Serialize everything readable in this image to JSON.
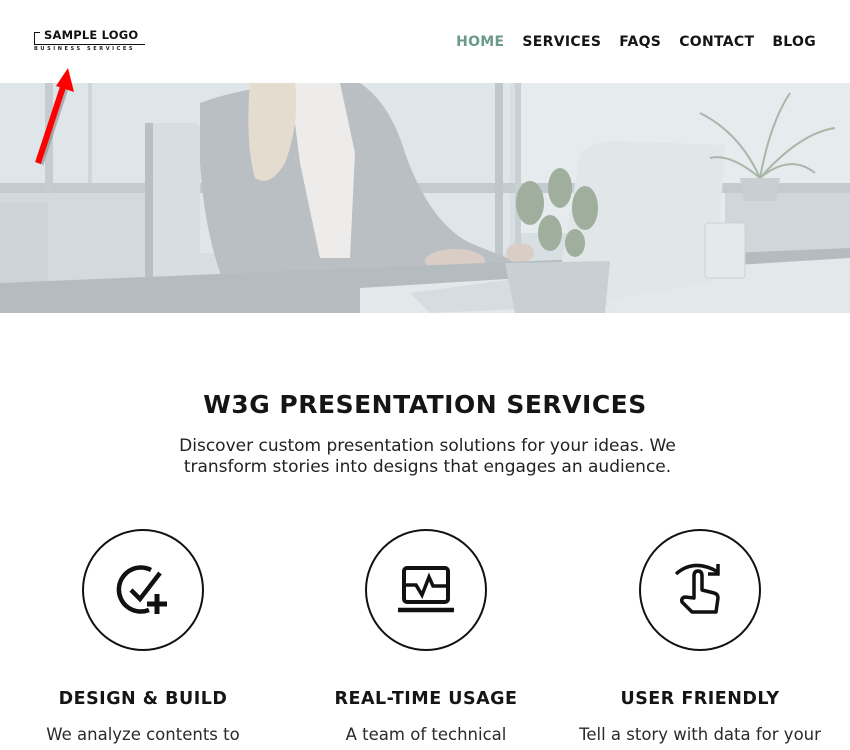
{
  "header": {
    "logo": {
      "main": "SAMPLE LOGO",
      "sub": "BUSINESS SERVICES"
    },
    "nav": [
      {
        "label": "HOME",
        "active": true
      },
      {
        "label": "SERVICES",
        "active": false
      },
      {
        "label": "FAQS",
        "active": false
      },
      {
        "label": "CONTACT",
        "active": false
      },
      {
        "label": "BLOG",
        "active": false
      }
    ],
    "active_color": "#6a9a88"
  },
  "hero": {
    "image": "office-woman-laptop-photo"
  },
  "annotation": {
    "icon": "red-arrow-icon",
    "color": "#ff0000",
    "points_to": "logo"
  },
  "services": {
    "title": "W3G PRESENTATION SERVICES",
    "subtitle_line1": "Discover custom presentation solutions for your ideas. We",
    "subtitle_line2": "transform stories into designs that engages an audience.",
    "features": [
      {
        "icon": "check-plus-icon",
        "title": "DESIGN & BUILD",
        "text": "We analyze contents to"
      },
      {
        "icon": "monitor-pulse-icon",
        "title": "REAL-TIME USAGE",
        "text": "A team of technical"
      },
      {
        "icon": "hand-swipe-icon",
        "title": "USER FRIENDLY",
        "text": "Tell a story with data for your"
      }
    ]
  }
}
